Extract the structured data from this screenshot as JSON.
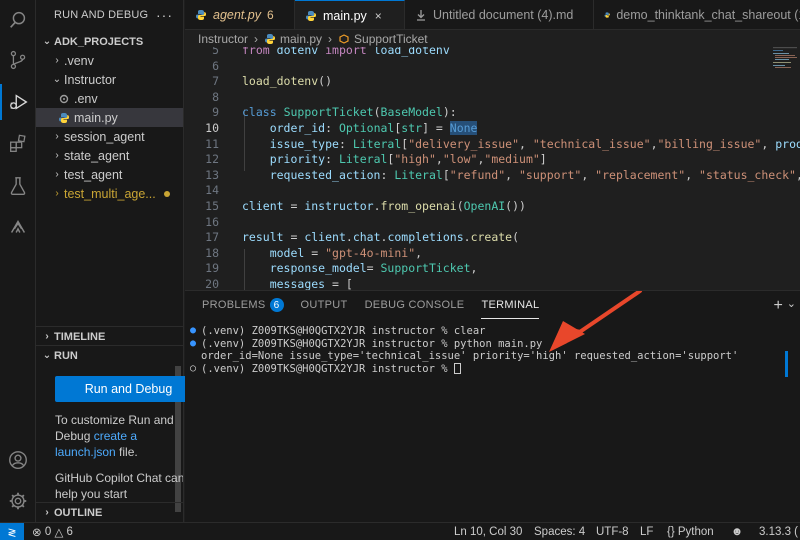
{
  "sidebar": {
    "title": "RUN AND DEBUG",
    "more": "···",
    "project": "ADK_PROJECTS",
    "tree": [
      {
        "label": ".venv"
      },
      {
        "label": "Instructor"
      },
      {
        "label": ".env"
      },
      {
        "label": "main.py"
      },
      {
        "label": "session_agent"
      },
      {
        "label": "state_agent"
      },
      {
        "label": "test_agent"
      },
      {
        "label": "test_multi_age..."
      }
    ],
    "timeline": "TIMELINE",
    "run": "RUN",
    "run_button": "Run and Debug",
    "customize_text_1": "To customize Run and Debug ",
    "customize_link_1": "create a launch.json",
    "customize_text_2": " file.",
    "copilot_text": "GitHub Copilot Chat can help you start",
    "outline": "OUTLINE"
  },
  "tabs": [
    {
      "label": "agent.py",
      "count": "6"
    },
    {
      "label": "main.py",
      "close": "×"
    },
    {
      "label": "Untitled document (4).md"
    },
    {
      "label": "demo_thinktank_chat_shareout (1)."
    }
  ],
  "breadcrumb": {
    "folder": "Instructor",
    "file": "main.py",
    "symbol": "SupportTicket"
  },
  "editor": {
    "lines": [
      {
        "n": "5",
        "code": "from dotenv import load_dotenv"
      },
      {
        "n": "6",
        "code": ""
      },
      {
        "n": "7",
        "code": "load_dotenv()"
      },
      {
        "n": "8",
        "code": ""
      },
      {
        "n": "9",
        "code": "class SupportTicket(BaseModel):"
      },
      {
        "n": "10",
        "code": "    order_id: Optional[str] = None"
      },
      {
        "n": "11",
        "code": "    issue_type: Literal[\"delivery_issue\", \"technical_issue\",\"billing_issue\", \"product_"
      },
      {
        "n": "12",
        "code": "    priority: Literal[\"high\",\"low\",\"medium\"]"
      },
      {
        "n": "13",
        "code": "    requested_action: Literal[\"refund\", \"support\", \"replacement\", \"status_check\", \"othe"
      },
      {
        "n": "14",
        "code": ""
      },
      {
        "n": "15",
        "code": "client = instructor.from_openai(OpenAI())"
      },
      {
        "n": "16",
        "code": ""
      },
      {
        "n": "17",
        "code": "result = client.chat.completions.create("
      },
      {
        "n": "18",
        "code": "    model = \"gpt-4o-mini\","
      },
      {
        "n": "19",
        "code": "    response_model= SupportTicket,"
      },
      {
        "n": "20",
        "code": "    messages = ["
      }
    ]
  },
  "panel": {
    "tabs": [
      {
        "label": "PROBLEMS",
        "badge": "6"
      },
      {
        "label": "OUTPUT"
      },
      {
        "label": "DEBUG CONSOLE"
      },
      {
        "label": "TERMINAL"
      }
    ],
    "actions": {
      "add": "+",
      "dropdown": "⌄"
    },
    "terminal": [
      "(.venv) Z009TKS@H0QGTX2YJR instructor % clear",
      "(.venv) Z009TKS@H0QGTX2YJR instructor % python main.py",
      "order_id=None issue_type='technical_issue' priority='high' requested_action='support'",
      "(.venv) Z009TKS@H0QGTX2YJR instructor % "
    ]
  },
  "status": {
    "errors": "0",
    "warnings": "6",
    "position": "Ln 10, Col 30",
    "spaces": "Spaces: 4",
    "encoding": "UTF-8",
    "eol": "LF",
    "language": "Python",
    "version": "3.13.3 ("
  },
  "colors": {
    "accent": "#0078d4",
    "arrow": "#e8472b",
    "badge": "#0078d4"
  }
}
